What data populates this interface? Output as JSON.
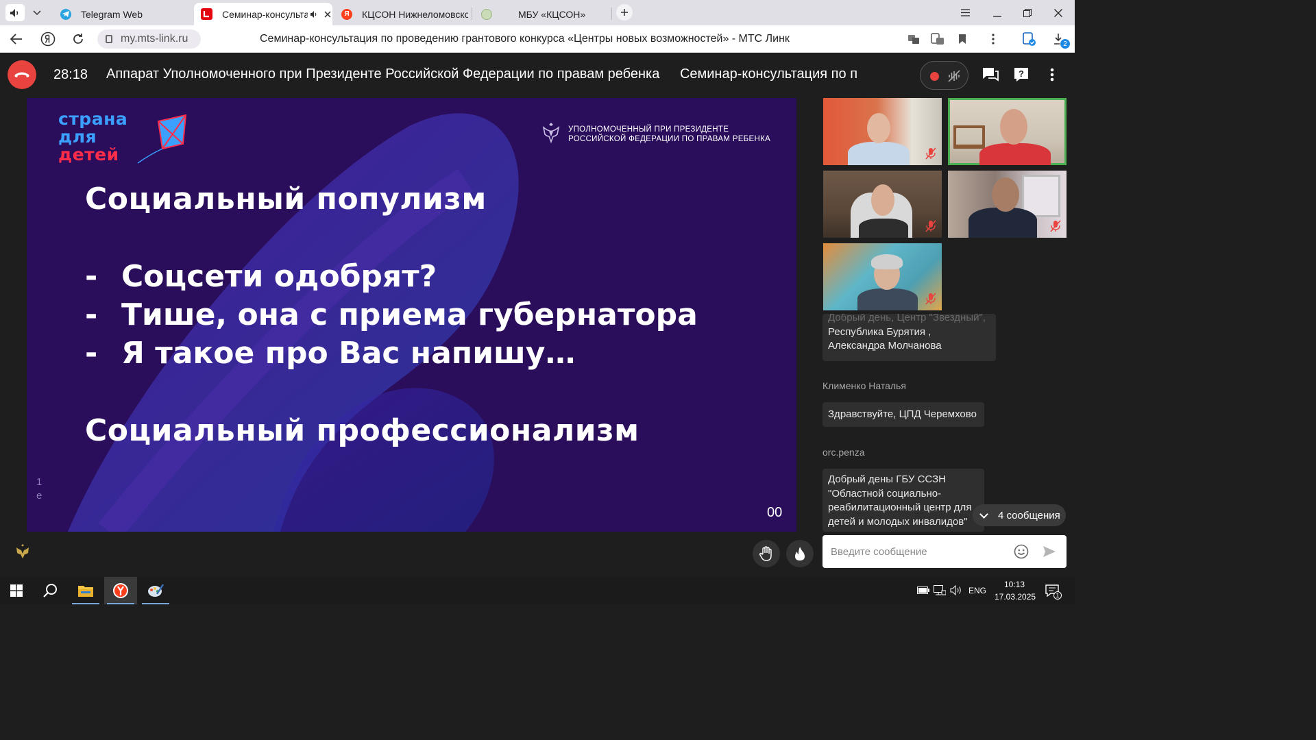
{
  "browser": {
    "tabs": [
      {
        "title": "Telegram Web",
        "icon": "telegram-icon"
      },
      {
        "title": "Семинар-консульта",
        "icon": "mts-link-icon",
        "active": true
      },
      {
        "title": "КЦСОН Нижнеломовског",
        "icon": "yandex-icon"
      },
      {
        "title": "МБУ «КЦСОН»",
        "icon": "site-icon"
      }
    ],
    "url": "my.mts-link.ru",
    "page_title": "Семинар-консультация по проведению грантового конкурса «Центры новых возможностей» - МТС Линк",
    "downloads_badge": "2"
  },
  "meeting": {
    "timer": "28:18",
    "title_1": "Аппарат Уполномоченного при Президенте Российской Федерации по правам ребенка",
    "title_2": "Семинар-консультация по п"
  },
  "slide": {
    "logo": [
      "страна",
      "для",
      "детей"
    ],
    "org_line_1": "УПОЛНОМОЧЕННЫЙ ПРИ ПРЕЗИДЕНТЕ",
    "org_line_2": "РОССИЙСКОЙ ФЕДЕРАЦИИ ПО ПРАВАМ РЕБЕНКА",
    "heading_1": "Социальный популизм",
    "bullets": [
      "Соцсети одобрят?",
      "Тише, она с приема губернатора",
      "Я такое про Вас напишу…"
    ],
    "bullet_marker": "-",
    "heading_2": "Социальный профессионализм",
    "page_number": "00",
    "side_text_1": "1",
    "side_text_2": "е"
  },
  "chat": {
    "messages": [
      {
        "author": "",
        "lines": [
          "Добрый день, Центр \"Звездный\",",
          "Республика Бурятия ,",
          "Александра Молчанова"
        ]
      },
      {
        "author": "Клименко Наталья",
        "lines": [
          "Здравствуйте, ЦПД Черемхово"
        ]
      },
      {
        "author": "orc.penza",
        "lines": [
          "Добрый дены ГБУ ССЗН",
          "\"Областной социально-",
          "реабилитационный центр для",
          "детей и молодых инвалидов\""
        ]
      }
    ],
    "new_messages": "4 сообщения",
    "input_placeholder": "Введите сообщение"
  },
  "taskbar": {
    "lang": "ENG",
    "time": "10:13",
    "date": "17.03.2025",
    "notifications": "1"
  },
  "colors": {
    "hangup": "#e8433f",
    "slide_bg": "#2a0e5c",
    "speaking_outline": "#4caf50",
    "logo_blue": "#3ba0ff",
    "logo_red": "#ff2d4a"
  }
}
